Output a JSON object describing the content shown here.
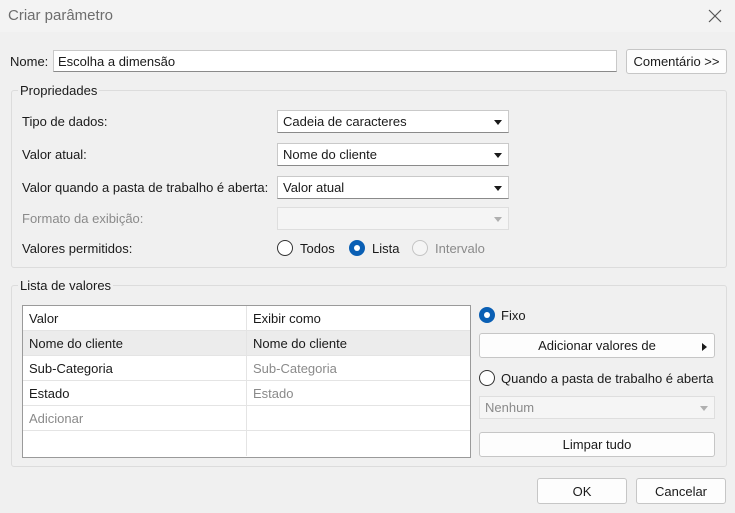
{
  "dialog": {
    "title": "Criar parâmetro",
    "close_icon": "close-icon"
  },
  "name": {
    "label": "Nome:",
    "value": "Escolha a dimensão",
    "comment_button": "Comentário >>"
  },
  "properties": {
    "group_title": "Propriedades",
    "data_type_label": "Tipo de dados:",
    "data_type_value": "Cadeia de caracteres",
    "current_value_label": "Valor atual:",
    "current_value_value": "Nome do cliente",
    "workbook_open_label": "Valor quando a pasta de trabalho é aberta:",
    "workbook_open_value": "Valor atual",
    "display_format_label": "Formato da exibição:",
    "display_format_value": "",
    "allowed_values_label": "Valores permitidos:",
    "allowed_options": [
      {
        "label": "Todos",
        "selected": false,
        "enabled": true
      },
      {
        "label": "Lista",
        "selected": true,
        "enabled": true
      },
      {
        "label": "Intervalo",
        "selected": false,
        "enabled": false
      }
    ]
  },
  "list": {
    "group_title": "Lista de valores",
    "columns": [
      "Valor",
      "Exibir como"
    ],
    "rows": [
      {
        "value": "Nome do cliente",
        "display": "Nome do cliente",
        "selected": true
      },
      {
        "value": "Sub-Categoria",
        "display": "Sub-Categoria",
        "selected": false
      },
      {
        "value": "Estado",
        "display": "Estado",
        "selected": false
      }
    ],
    "add_placeholder": "Adicionar",
    "fixed_label": "Fixo",
    "add_values_button": "Adicionar valores de",
    "when_open_label": "Quando a pasta de trabalho é aberta",
    "when_open_select": "Nenhum",
    "clear_button": "Limpar tudo"
  },
  "footer": {
    "ok": "OK",
    "cancel": "Cancelar"
  },
  "colors": {
    "accent": "#0a5fb4"
  }
}
